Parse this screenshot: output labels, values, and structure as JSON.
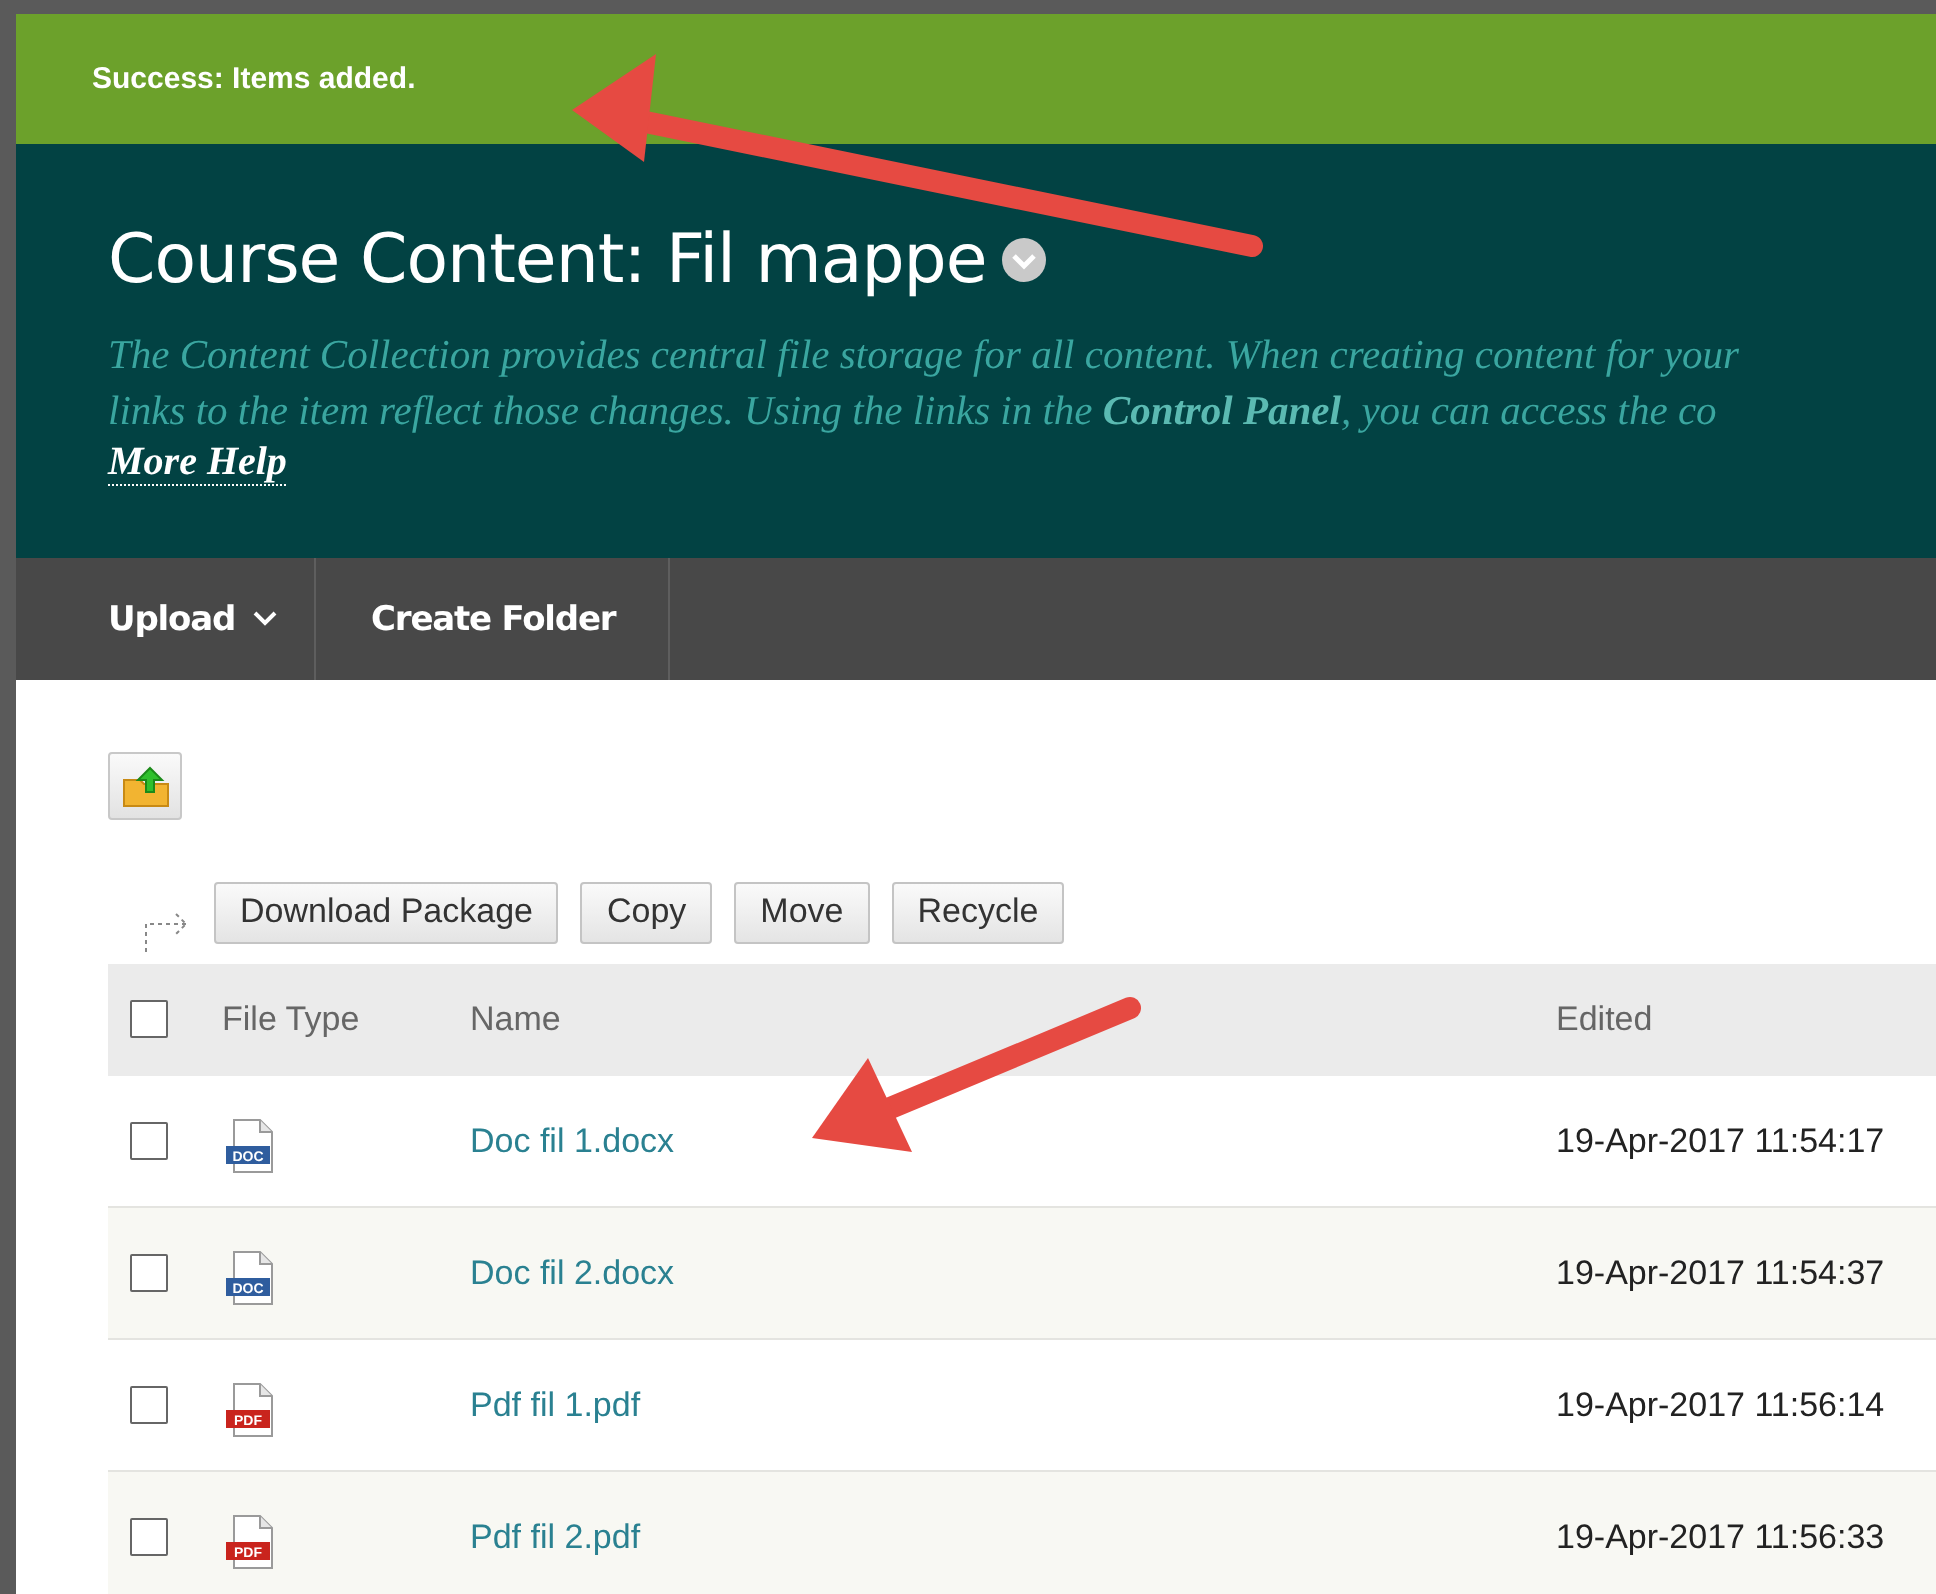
{
  "notice": {
    "text": "Success: Items added."
  },
  "header": {
    "title": "Course Content: Fil mappe",
    "description": [
      "The Content Collection provides central file storage for all content. When creating content for your",
      "links to the item reflect those changes. Using the links in the **Control Panel**, you can access the co"
    ],
    "help_link": "More Help"
  },
  "toolbar": [
    {
      "label": "Upload",
      "menu": true
    },
    {
      "label": "Create Folder",
      "menu": false
    }
  ],
  "actions": [
    "Download Package",
    "Copy",
    "Move",
    "Recycle"
  ],
  "table": {
    "columns": [
      "File Type",
      "Name",
      "Edited"
    ],
    "select_all": {
      "checked": false
    },
    "rows": [
      {
        "checked": false,
        "kind": "doc",
        "type_label": "DOC",
        "name": "Doc fil 1.docx",
        "edited": "19-Apr-2017 11:54:17"
      },
      {
        "checked": false,
        "kind": "doc",
        "type_label": "DOC",
        "name": "Doc fil 2.docx",
        "edited": "19-Apr-2017 11:54:37"
      },
      {
        "checked": false,
        "kind": "pdf",
        "type_label": "PDF",
        "name": "Pdf fil 1.pdf",
        "edited": "19-Apr-2017 11:56:14"
      },
      {
        "checked": false,
        "kind": "pdf",
        "type_label": "PDF",
        "name": "Pdf fil 2.pdf",
        "edited": "19-Apr-2017 11:56:33"
      }
    ]
  }
}
